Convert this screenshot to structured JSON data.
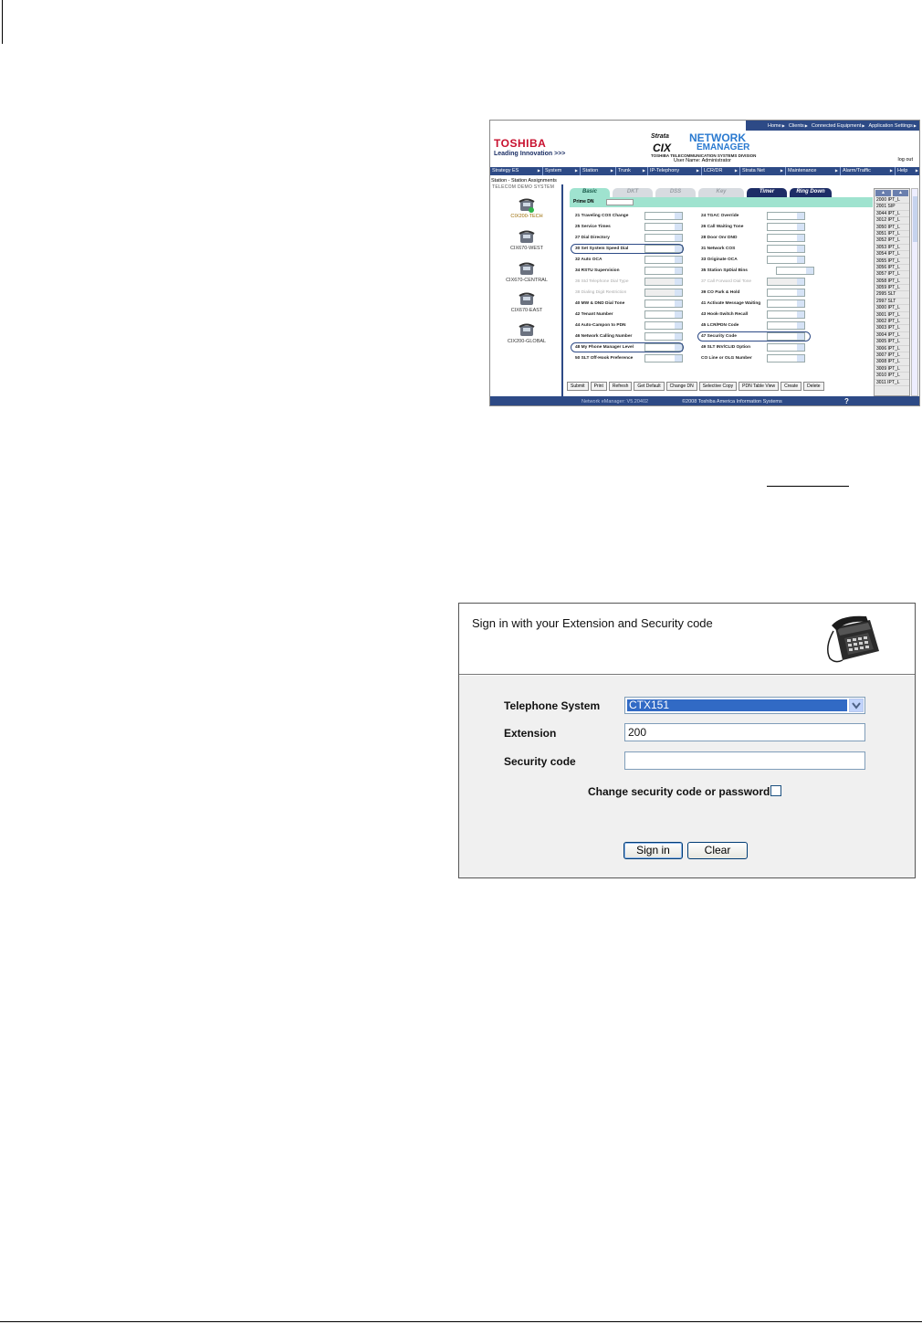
{
  "emanager": {
    "top_nav": [
      "Home",
      "Clients",
      "Connected Equipment",
      "Application Settings"
    ],
    "brand": "TOSHIBA",
    "tagline": "Leading Innovation >>>",
    "product_strata": "Strata",
    "product_cix": "CIX",
    "product_line1": "NETWORK",
    "product_line2": "EMANAGER",
    "division": "TOSHIBA TELECOMMUNICATION SYSTEMS DIVISION",
    "user_name": "User Name: Administrator",
    "logout": "log out",
    "main_nav": [
      "Strategy ES",
      "System",
      "Station",
      "Trunk",
      "IP-Telephony",
      "LCR/DR",
      "Strata Net",
      "Maintenance",
      "Alarm/Traffic",
      "Help"
    ],
    "breadcrumb": "Station - Station Assignments",
    "sidebar_header": "TELECOM DEMO SYSTEM",
    "systems": [
      "CIX200-TECH",
      "CIX670-WEST",
      "CIX670-CENTRAL",
      "CIX670-EAST",
      "CIX200-GLOBAL"
    ],
    "tabs": [
      "Basic",
      "DKT",
      "DSS",
      "Key",
      "Timer",
      "Ring Down"
    ],
    "prime_dn_label": "Prime DN",
    "fields_left": [
      {
        "label": "21 Traveling COS Change",
        "disabled": false
      },
      {
        "label": "25 Service Times",
        "disabled": false
      },
      {
        "label": "27 Dial Directory",
        "disabled": false
      },
      {
        "label": "30 Set System Speed Dial",
        "disabled": false
      },
      {
        "label": "32 Auto OCA",
        "disabled": false
      },
      {
        "label": "34 RSTU Supervision",
        "disabled": false
      },
      {
        "label": "36 Std Telephone Dial Type",
        "disabled": true
      },
      {
        "label": "38 Dialing Digit Restriction",
        "disabled": true
      },
      {
        "label": "40 MW & DND Dial Tone",
        "disabled": false
      },
      {
        "label": "42 Tenant Number",
        "disabled": false
      },
      {
        "label": "44 Auto-Campon to PDN",
        "disabled": false
      },
      {
        "label": "46 Network Calling Number",
        "disabled": false
      },
      {
        "label": "48 My Phone Manager Level",
        "disabled": false
      },
      {
        "label": "50 SLT Off-Hook Preference",
        "disabled": false
      }
    ],
    "fields_right": [
      {
        "label": "24 TGAC Override",
        "disabled": false
      },
      {
        "label": "26 Call Waiting Tone",
        "disabled": false
      },
      {
        "label": "28 Door Onr DND",
        "disabled": false
      },
      {
        "label": "31 Network COS",
        "disabled": false
      },
      {
        "label": "33 Originate OCA",
        "disabled": false
      },
      {
        "label": "35 Station SpDial Bins",
        "disabled": false
      },
      {
        "label": "37 Call Forward Dial Tone",
        "disabled": true
      },
      {
        "label": "39 CO Park & Hold",
        "disabled": false
      },
      {
        "label": "41 Activate Message Waiting",
        "disabled": false
      },
      {
        "label": "43 Hook-Switch Recall",
        "disabled": false
      },
      {
        "label": "45 LCR/PDN Code",
        "disabled": false
      },
      {
        "label": "47 Security Code",
        "disabled": false
      },
      {
        "label": "49 SLT INV/CLID Option",
        "disabled": false
      },
      {
        "label": "CO Line or OLG Number",
        "disabled": false
      }
    ],
    "buttons": [
      "Submit",
      "Print",
      "Refresh",
      "Get Default",
      "Change DN",
      "Selective Copy",
      "PDN Table View",
      "Create",
      "Delete"
    ],
    "dn_list": [
      "2000 IPT_L",
      "2001 SIP",
      "3044 IPT_L",
      "3012 IPT_L",
      "3050 IPT_L",
      "3051 IPT_L",
      "3052 IPT_L",
      "3053 IPT_L",
      "3054 IPT_L",
      "3055 IPT_L",
      "3056 IPT_L",
      "3057 IPT_L",
      "3058 IPT_L",
      "3059 IPT_L",
      "2995 SLT",
      "2997 SLT",
      "3000 IPT_L",
      "3001 IPT_L",
      "3002 IPT_L",
      "3003 IPT_L",
      "3004 IPT_L",
      "3005 IPT_L",
      "3006 IPT_L",
      "3007 IPT_L",
      "3008 IPT_L",
      "3009 IPT_L",
      "3010 IPT_L",
      "3011 IPT_L"
    ],
    "footer_version": "Network eManager: V5.20402",
    "footer_copyright": "©2008 Toshiba America Information Systems",
    "footer_help": "?"
  },
  "signin": {
    "title": "Sign in with your Extension and Security code",
    "telephone_system_label": "Telephone System",
    "telephone_system_value": "CTX151",
    "extension_label": "Extension",
    "extension_value": "200",
    "security_code_label": "Security code",
    "security_code_value": "",
    "change_label": "Change security code or password",
    "change_checked": false,
    "signin_button": "Sign in",
    "clear_button": "Clear"
  }
}
